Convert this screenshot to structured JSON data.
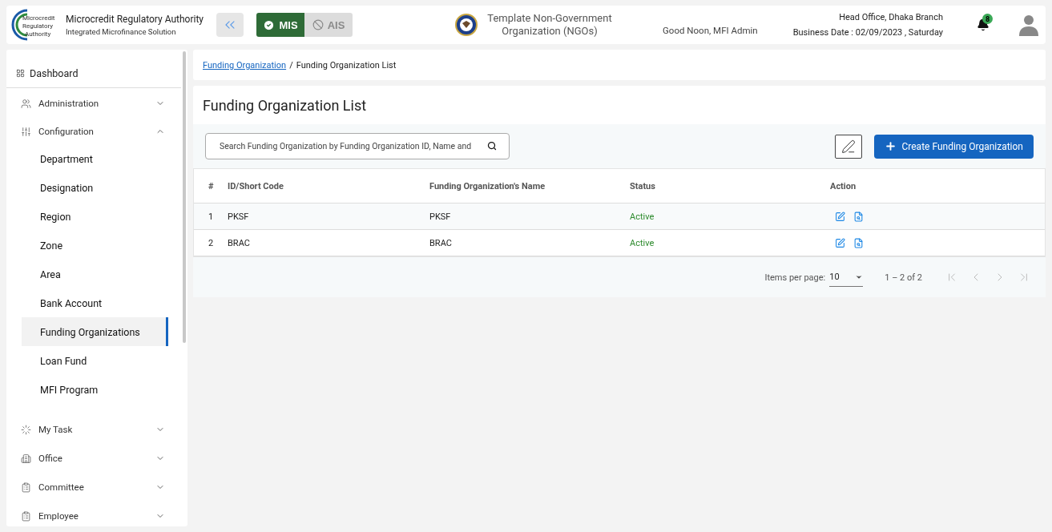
{
  "header": {
    "logo_text": [
      "Microcredit",
      "Regulatory",
      "Authority"
    ],
    "title": "Microcredit Regulatory Authority",
    "subtitle": "Integrated Microfinance Solution",
    "modules": [
      {
        "label": "MIS",
        "selected": true
      },
      {
        "label": "AIS",
        "selected": false
      }
    ],
    "organization": "Template Non-Government Organization (NGOs)",
    "greeting": "Good Noon, MFI Admin",
    "office": "Head Office, Dhaka Branch",
    "business_date": "Business Date : 02/09/2023 , Saturday",
    "notification_count": "8"
  },
  "sidebar": {
    "dashboard": "Dashboard",
    "items": [
      {
        "label": "Administration",
        "kind": "admin",
        "expanded": false
      },
      {
        "label": "Configuration",
        "kind": "config",
        "expanded": true,
        "children": [
          {
            "label": "Department",
            "selected": false
          },
          {
            "label": "Designation",
            "selected": false
          },
          {
            "label": "Region",
            "selected": false
          },
          {
            "label": "Zone",
            "selected": false
          },
          {
            "label": "Area",
            "selected": false
          },
          {
            "label": "Bank Account",
            "selected": false
          },
          {
            "label": "Funding Organizations",
            "selected": true
          },
          {
            "label": "Loan Fund",
            "selected": false
          },
          {
            "label": "MFI Program",
            "selected": false
          }
        ]
      },
      {
        "label": "My Task",
        "kind": "task",
        "expanded": false
      },
      {
        "label": "Office",
        "kind": "office",
        "expanded": false
      },
      {
        "label": "Committee",
        "kind": "committee",
        "expanded": false
      },
      {
        "label": "Employee",
        "kind": "committee",
        "expanded": false
      }
    ]
  },
  "breadcrumb": {
    "link": "Funding Organization",
    "separator": "/",
    "current": "Funding Organization List"
  },
  "page_title": "Funding Organization List",
  "search": {
    "placeholder": "Search Funding Organization by Funding Organization ID, Name and"
  },
  "create_button": "Create Funding Organization",
  "table": {
    "columns": [
      "#",
      "ID/Short Code",
      "Funding Organization's Name",
      "Status",
      "Action"
    ],
    "rows": [
      {
        "index": "1",
        "code": "PKSF",
        "name": "PKSF",
        "status": "Active"
      },
      {
        "index": "2",
        "code": "BRAC",
        "name": "BRAC",
        "status": "Active"
      }
    ]
  },
  "pagination": {
    "items_per_page_label": "Items per page:",
    "page_size": "10",
    "range": "1 – 2 of 2",
    "buttons": [
      {
        "kind": "first",
        "disabled": true
      },
      {
        "kind": "prev",
        "disabled": true
      },
      {
        "kind": "next",
        "disabled": true
      },
      {
        "kind": "last",
        "disabled": true
      }
    ]
  }
}
